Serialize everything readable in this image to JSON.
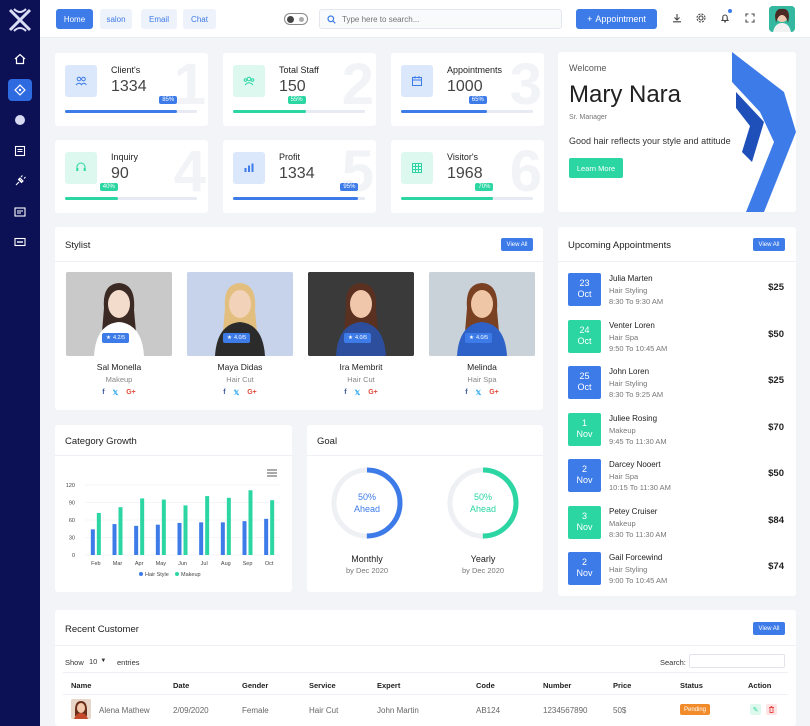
{
  "header": {
    "nav": [
      "Home",
      "salon",
      "Email",
      "Chat"
    ],
    "search_placeholder": "Type here to search...",
    "appointment_button": "Appointment"
  },
  "stats": [
    {
      "label": "Client's",
      "value": "1334",
      "percent": "85%",
      "fill": 0.85,
      "color": "#3d7be8",
      "bg_number": "1"
    },
    {
      "label": "Total Staff",
      "value": "150",
      "percent": "55%",
      "fill": 0.55,
      "color": "#2bd6a3",
      "bg_number": "2"
    },
    {
      "label": "Appointments",
      "value": "1000",
      "percent": "65%",
      "fill": 0.65,
      "color": "#3d7be8",
      "bg_number": "3"
    },
    {
      "label": "Inquiry",
      "value": "90",
      "percent": "40%",
      "fill": 0.4,
      "color": "#2bd6a3",
      "bg_number": "4"
    },
    {
      "label": "Profit",
      "value": "1334",
      "percent": "95%",
      "fill": 0.95,
      "color": "#3d7be8",
      "bg_number": "5"
    },
    {
      "label": "Visitor's",
      "value": "1968",
      "percent": "70%",
      "fill": 0.7,
      "color": "#2bd6a3",
      "bg_number": "6"
    }
  ],
  "welcome": {
    "greeting": "Welcome",
    "name": "Mary Nara",
    "role": "Sr. Manager",
    "tagline": "Good hair reflects your style and attitude",
    "button": "Learn More"
  },
  "stylist": {
    "title": "Stylist",
    "view_all": "View All",
    "people": [
      {
        "name": "Sal Monella",
        "role": "Makeup",
        "rating": "4.2/5"
      },
      {
        "name": "Maya Didas",
        "role": "Hair Cut",
        "rating": "4.0/5"
      },
      {
        "name": "Ira Membrit",
        "role": "Hair Cut",
        "rating": "4.0/5"
      },
      {
        "name": "Melinda",
        "role": "Hair Spa",
        "rating": "4.0/5"
      }
    ]
  },
  "upcoming": {
    "title": "Upcoming Appointments",
    "view_all": "View All",
    "items": [
      {
        "day": "23",
        "month": "Oct",
        "name": "Julia Marten",
        "service": "Hair Styling",
        "time": "8:30 To 9:30 AM",
        "price": "$25",
        "color": "#3d7be8"
      },
      {
        "day": "24",
        "month": "Oct",
        "name": "Venter Loren",
        "service": "Hair Spa",
        "time": "9:50 To 10:45 AM",
        "price": "$50",
        "color": "#2bd6a3"
      },
      {
        "day": "25",
        "month": "Oct",
        "name": "John Loren",
        "service": "Hair Styling",
        "time": "8:30 To 9:25 AM",
        "price": "$25",
        "color": "#3d7be8"
      },
      {
        "day": "1",
        "month": "Nov",
        "name": "Juliee Rosing",
        "service": "Makeup",
        "time": "9:45 To 11:30 AM",
        "price": "$70",
        "color": "#2bd6a3"
      },
      {
        "day": "2",
        "month": "Nov",
        "name": "Darcey Nooert",
        "service": "Hair Spa",
        "time": "10:15 To 11:30 AM",
        "price": "$50",
        "color": "#3d7be8"
      },
      {
        "day": "3",
        "month": "Nov",
        "name": "Petey Cruiser",
        "service": "Makeup",
        "time": "8:30 To 11:30 AM",
        "price": "$84",
        "color": "#2bd6a3"
      },
      {
        "day": "2",
        "month": "Nov",
        "name": "Gail Forcewind",
        "service": "Hair Styling",
        "time": "9:00 To 10:45 AM",
        "price": "$74",
        "color": "#3d7be8"
      }
    ]
  },
  "category": {
    "title": "Category Growth"
  },
  "chart_data": {
    "type": "bar",
    "categories": [
      "Feb",
      "Mar",
      "Apr",
      "May",
      "Jun",
      "Jul",
      "Aug",
      "Sep",
      "Oct"
    ],
    "series": [
      {
        "name": "Hair Style",
        "values": [
          44,
          53,
          50,
          52,
          55,
          56,
          56,
          58,
          62
        ],
        "color": "#3d7be8"
      },
      {
        "name": "Makeup",
        "values": [
          72,
          82,
          97,
          95,
          85,
          101,
          98,
          111,
          94
        ],
        "color": "#2bd6a3"
      }
    ],
    "yticks": [
      "120",
      "90",
      "60",
      "30",
      "0"
    ],
    "ylim": [
      0,
      120
    ],
    "legend": "bottom"
  },
  "goal": {
    "title": "Goal",
    "items": [
      {
        "percent": "50%",
        "label": "Ahead",
        "fraction": 0.5,
        "name": "Monthly",
        "sub": "by Dec 2020",
        "color": "#3d7be8"
      },
      {
        "percent": "50%",
        "label": "Ahead",
        "fraction": 0.5,
        "name": "Yearly",
        "sub": "by Dec 2020",
        "color": "#2bd6a3"
      }
    ]
  },
  "customers": {
    "title": "Recent Customer",
    "view_all": "View All",
    "show": "Show",
    "entries_value": "10",
    "entries": "entries",
    "search": "Search:",
    "columns": [
      "Name",
      "Date",
      "Gender",
      "Service",
      "Expert",
      "Code",
      "Number",
      "Price",
      "Status",
      "Action"
    ],
    "row": [
      "Alena Mathew",
      "2/09/2020",
      "Female",
      "Hair Cut",
      "John Martin",
      "AB124",
      "1234567890",
      "50$",
      "Pending"
    ]
  }
}
